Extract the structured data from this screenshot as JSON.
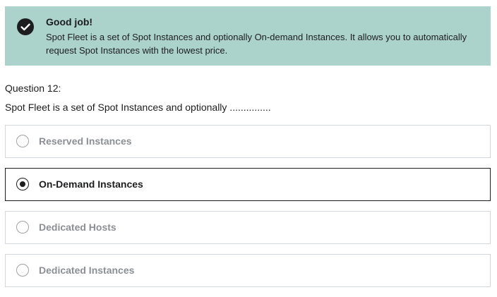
{
  "alert": {
    "icon": "check-circle-icon",
    "title": "Good job!",
    "body_line1": "Spot Fleet is a set of Spot Instances and optionally On-demand Instances. It allows you to automatically",
    "body_line2": "request Spot Instances with the lowest price."
  },
  "question": {
    "number_label": "Question 12:",
    "text": "Spot Fleet is a set of Spot Instances and optionally ..............."
  },
  "options": [
    {
      "label": "Reserved Instances",
      "selected": false
    },
    {
      "label": "On-Demand Instances",
      "selected": true
    },
    {
      "label": "Dedicated Hosts",
      "selected": false
    },
    {
      "label": "Dedicated Instances",
      "selected": false
    }
  ],
  "colors": {
    "alert_background": "#acd2cc",
    "text_dark": "#1c1d1f",
    "text_muted": "#8c8f93",
    "border": "#d1d7dc"
  }
}
